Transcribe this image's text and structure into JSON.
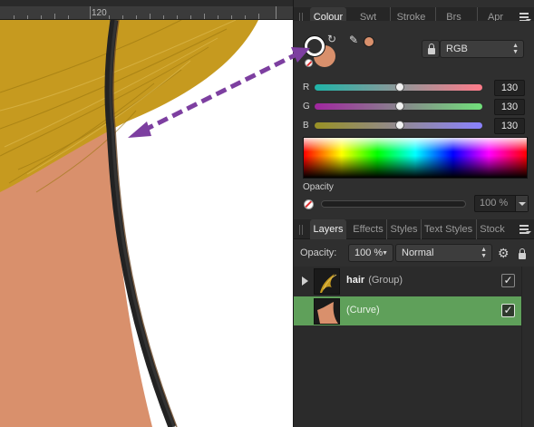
{
  "ruler": {
    "label": "120"
  },
  "colour_panel": {
    "tabs": [
      {
        "label": "Colour",
        "active": true
      },
      {
        "label": "Swt",
        "active": false
      },
      {
        "label": "Stroke",
        "active": false
      },
      {
        "label": "Brs",
        "active": false
      },
      {
        "label": "Apr",
        "active": false
      }
    ],
    "color_model": "RGB",
    "current_fill": "#d9906c",
    "sliders": [
      {
        "label": "R",
        "value": "130",
        "level": 0.51,
        "gradient": [
          "#1fb4a8",
          "#ff7b8a"
        ]
      },
      {
        "label": "G",
        "value": "130",
        "level": 0.51,
        "gradient": [
          "#a0269f",
          "#70e07a"
        ]
      },
      {
        "label": "B",
        "value": "130",
        "level": 0.51,
        "gradient": [
          "#999124",
          "#8a82ff"
        ]
      }
    ],
    "opacity_label": "Opacity",
    "opacity_value": "100 %"
  },
  "layers_panel": {
    "tabs": [
      {
        "label": "Layers",
        "active": true
      },
      {
        "label": "Effects",
        "active": false
      },
      {
        "label": "Styles",
        "active": false
      },
      {
        "label": "Text Styles",
        "active": false
      },
      {
        "label": "Stock",
        "active": false
      }
    ],
    "opacity_label": "Opacity:",
    "opacity_value": "100 %",
    "blend_mode": "Normal",
    "layers": [
      {
        "name": "hair",
        "type": "(Group)",
        "visible": true,
        "selected": false,
        "expandable": true
      },
      {
        "name": "",
        "type": "(Curve)",
        "visible": true,
        "selected": true,
        "expandable": false
      }
    ]
  },
  "colors": {
    "skin": "#d9906c",
    "hair": "#c69a1f",
    "arrow": "#7d3fa0",
    "selection": "#5fa05a"
  }
}
